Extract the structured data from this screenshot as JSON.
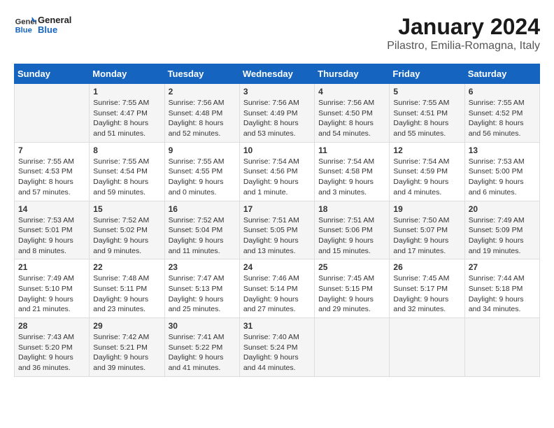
{
  "logo": {
    "text_general": "General",
    "text_blue": "Blue"
  },
  "title": "January 2024",
  "location": "Pilastro, Emilia-Romagna, Italy",
  "days_of_week": [
    "Sunday",
    "Monday",
    "Tuesday",
    "Wednesday",
    "Thursday",
    "Friday",
    "Saturday"
  ],
  "weeks": [
    [
      {
        "day": "",
        "info": ""
      },
      {
        "day": "1",
        "info": "Sunrise: 7:55 AM\nSunset: 4:47 PM\nDaylight: 8 hours\nand 51 minutes."
      },
      {
        "day": "2",
        "info": "Sunrise: 7:56 AM\nSunset: 4:48 PM\nDaylight: 8 hours\nand 52 minutes."
      },
      {
        "day": "3",
        "info": "Sunrise: 7:56 AM\nSunset: 4:49 PM\nDaylight: 8 hours\nand 53 minutes."
      },
      {
        "day": "4",
        "info": "Sunrise: 7:56 AM\nSunset: 4:50 PM\nDaylight: 8 hours\nand 54 minutes."
      },
      {
        "day": "5",
        "info": "Sunrise: 7:55 AM\nSunset: 4:51 PM\nDaylight: 8 hours\nand 55 minutes."
      },
      {
        "day": "6",
        "info": "Sunrise: 7:55 AM\nSunset: 4:52 PM\nDaylight: 8 hours\nand 56 minutes."
      }
    ],
    [
      {
        "day": "7",
        "info": "Sunrise: 7:55 AM\nSunset: 4:53 PM\nDaylight: 8 hours\nand 57 minutes."
      },
      {
        "day": "8",
        "info": "Sunrise: 7:55 AM\nSunset: 4:54 PM\nDaylight: 8 hours\nand 59 minutes."
      },
      {
        "day": "9",
        "info": "Sunrise: 7:55 AM\nSunset: 4:55 PM\nDaylight: 9 hours\nand 0 minutes."
      },
      {
        "day": "10",
        "info": "Sunrise: 7:54 AM\nSunset: 4:56 PM\nDaylight: 9 hours\nand 1 minute."
      },
      {
        "day": "11",
        "info": "Sunrise: 7:54 AM\nSunset: 4:58 PM\nDaylight: 9 hours\nand 3 minutes."
      },
      {
        "day": "12",
        "info": "Sunrise: 7:54 AM\nSunset: 4:59 PM\nDaylight: 9 hours\nand 4 minutes."
      },
      {
        "day": "13",
        "info": "Sunrise: 7:53 AM\nSunset: 5:00 PM\nDaylight: 9 hours\nand 6 minutes."
      }
    ],
    [
      {
        "day": "14",
        "info": "Sunrise: 7:53 AM\nSunset: 5:01 PM\nDaylight: 9 hours\nand 8 minutes."
      },
      {
        "day": "15",
        "info": "Sunrise: 7:52 AM\nSunset: 5:02 PM\nDaylight: 9 hours\nand 9 minutes."
      },
      {
        "day": "16",
        "info": "Sunrise: 7:52 AM\nSunset: 5:04 PM\nDaylight: 9 hours\nand 11 minutes."
      },
      {
        "day": "17",
        "info": "Sunrise: 7:51 AM\nSunset: 5:05 PM\nDaylight: 9 hours\nand 13 minutes."
      },
      {
        "day": "18",
        "info": "Sunrise: 7:51 AM\nSunset: 5:06 PM\nDaylight: 9 hours\nand 15 minutes."
      },
      {
        "day": "19",
        "info": "Sunrise: 7:50 AM\nSunset: 5:07 PM\nDaylight: 9 hours\nand 17 minutes."
      },
      {
        "day": "20",
        "info": "Sunrise: 7:49 AM\nSunset: 5:09 PM\nDaylight: 9 hours\nand 19 minutes."
      }
    ],
    [
      {
        "day": "21",
        "info": "Sunrise: 7:49 AM\nSunset: 5:10 PM\nDaylight: 9 hours\nand 21 minutes."
      },
      {
        "day": "22",
        "info": "Sunrise: 7:48 AM\nSunset: 5:11 PM\nDaylight: 9 hours\nand 23 minutes."
      },
      {
        "day": "23",
        "info": "Sunrise: 7:47 AM\nSunset: 5:13 PM\nDaylight: 9 hours\nand 25 minutes."
      },
      {
        "day": "24",
        "info": "Sunrise: 7:46 AM\nSunset: 5:14 PM\nDaylight: 9 hours\nand 27 minutes."
      },
      {
        "day": "25",
        "info": "Sunrise: 7:45 AM\nSunset: 5:15 PM\nDaylight: 9 hours\nand 29 minutes."
      },
      {
        "day": "26",
        "info": "Sunrise: 7:45 AM\nSunset: 5:17 PM\nDaylight: 9 hours\nand 32 minutes."
      },
      {
        "day": "27",
        "info": "Sunrise: 7:44 AM\nSunset: 5:18 PM\nDaylight: 9 hours\nand 34 minutes."
      }
    ],
    [
      {
        "day": "28",
        "info": "Sunrise: 7:43 AM\nSunset: 5:20 PM\nDaylight: 9 hours\nand 36 minutes."
      },
      {
        "day": "29",
        "info": "Sunrise: 7:42 AM\nSunset: 5:21 PM\nDaylight: 9 hours\nand 39 minutes."
      },
      {
        "day": "30",
        "info": "Sunrise: 7:41 AM\nSunset: 5:22 PM\nDaylight: 9 hours\nand 41 minutes."
      },
      {
        "day": "31",
        "info": "Sunrise: 7:40 AM\nSunset: 5:24 PM\nDaylight: 9 hours\nand 44 minutes."
      },
      {
        "day": "",
        "info": ""
      },
      {
        "day": "",
        "info": ""
      },
      {
        "day": "",
        "info": ""
      }
    ]
  ]
}
